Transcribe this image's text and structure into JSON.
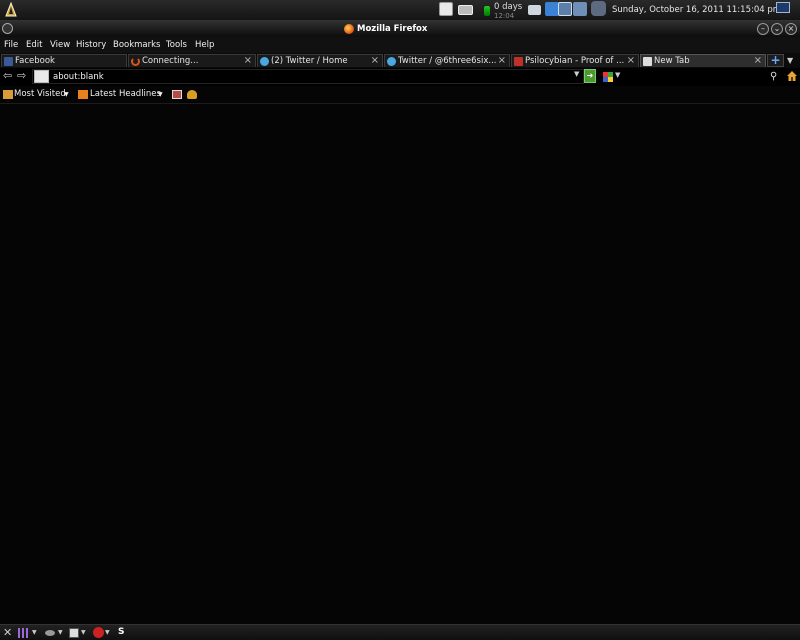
{
  "system_panel": {
    "uptime_label": "0 days",
    "uptime_second": "12:04",
    "clock": "Sunday, October 16, 2011  11:15:04 pm"
  },
  "window": {
    "title": "Mozilla Firefox"
  },
  "menubar": {
    "items": [
      "File",
      "Edit",
      "View",
      "History",
      "Bookmarks",
      "Tools",
      "Help"
    ]
  },
  "tabs": [
    {
      "label": "Facebook",
      "icon": "facebook-icon",
      "color": "#3b5998"
    },
    {
      "label": "Connecting...",
      "icon": "loading-icon",
      "color": "#d5541c"
    },
    {
      "label": "(2) Twitter / Home",
      "icon": "twitter-icon",
      "color": "#4aa8e0"
    },
    {
      "label": "Twitter / @6three6six...",
      "icon": "twitter-icon",
      "color": "#4aa8e0"
    },
    {
      "label": "Psilocybian - Proof of ...",
      "icon": "site-icon",
      "color": "#c0302a"
    },
    {
      "label": "New Tab",
      "icon": "blank-page-icon",
      "color": "#dddddd"
    }
  ],
  "navbar": {
    "url": "about:blank"
  },
  "bookmarks": {
    "most_visited": "Most Visited",
    "latest_headlines": "Latest Headlines"
  },
  "bottom_panel": {
    "s_label": "S"
  },
  "colors": {
    "background": "#050505",
    "accent_blue": "#6fa8ff",
    "go_green": "#4a9a2c"
  }
}
